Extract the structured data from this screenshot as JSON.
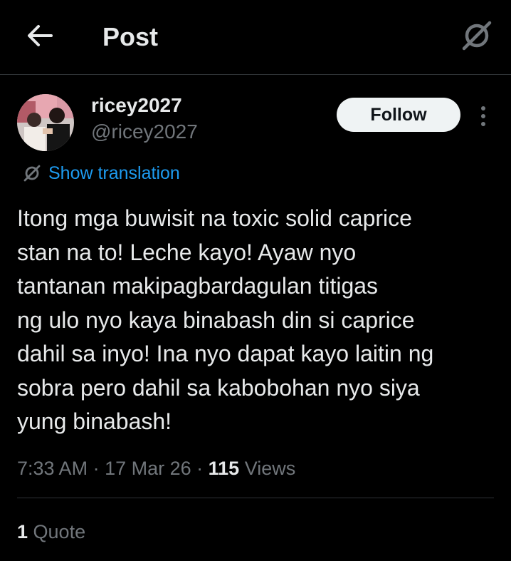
{
  "header": {
    "title": "Post",
    "back_icon": "arrow-left-icon",
    "grok_icon": "grok-icon"
  },
  "author": {
    "display_name": "ricey2027",
    "handle": "@ricey2027",
    "follow_label": "Follow",
    "more_icon": "more-vertical-icon"
  },
  "translation": {
    "icon": "grok-icon",
    "label": "Show translation"
  },
  "post": {
    "text": "Itong mga buwisit na toxic solid caprice\nstan na to! Leche kayo! Ayaw nyo\ntantanan makipagbardagulan titigas\nng ulo nyo kaya binabash din si caprice\ndahil sa inyo! Ina nyo dapat kayo laitin ng\nsobra pero dahil sa kabobohan nyo siya\nyung binabash!",
    "time": "7:33 AM",
    "sep1": " · ",
    "date": "17 Mar 26",
    "sep2": " · ",
    "views_count": "115",
    "views_label": " Views"
  },
  "engagement": {
    "quotes_count": "1",
    "quotes_label": " Quote"
  },
  "colors": {
    "background": "#000000",
    "text_primary": "#e7e9ea",
    "text_secondary": "#71767b",
    "link": "#1d9bf0",
    "follow_bg": "#eff3f4",
    "divider": "#2f3336"
  }
}
